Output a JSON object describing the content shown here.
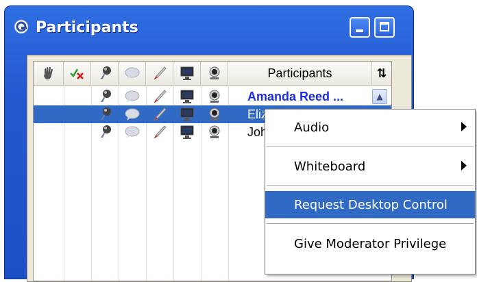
{
  "window": {
    "title": "Participants",
    "icons": {
      "title": "webex-logo-icon",
      "minimize": "minimize-icon",
      "maximize": "maximize-icon"
    }
  },
  "header": {
    "columns": [
      {
        "name": "raise-hand-icon"
      },
      {
        "name": "check-x-icon"
      },
      {
        "name": "microphone-icon"
      },
      {
        "name": "chat-bubble-icon"
      },
      {
        "name": "pen-icon"
      },
      {
        "name": "monitor-icon"
      },
      {
        "name": "webcam-icon"
      }
    ],
    "participants_label": "Participants",
    "sort_icon": "⇅"
  },
  "participants": [
    {
      "name": "Amanda Reed ...",
      "bold": true,
      "selected": false
    },
    {
      "name": "Elizabeth",
      "bold": false,
      "selected": true
    },
    {
      "name": "John",
      "bold": false,
      "selected": false
    }
  ],
  "context_menu": {
    "items": [
      {
        "label": "Audio",
        "submenu": true,
        "selected": false
      },
      {
        "label": "Whiteboard",
        "submenu": true,
        "selected": false
      },
      {
        "label": "Request Desktop Control",
        "submenu": false,
        "selected": true
      },
      {
        "label": "Give Moderator Privilege",
        "submenu": false,
        "selected": false
      }
    ]
  },
  "colors": {
    "title_bar": "#2559d0",
    "selection": "#316ac5",
    "moderator_name": "#1d2ee8"
  }
}
